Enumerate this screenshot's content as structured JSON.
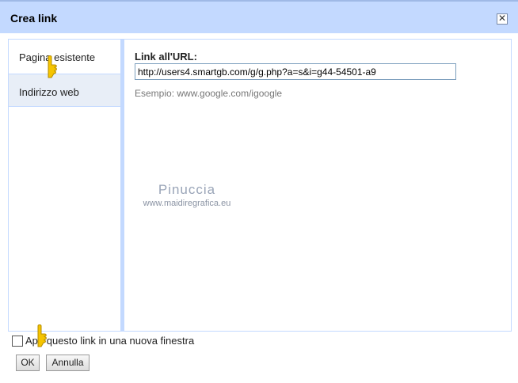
{
  "dialog": {
    "title": "Crea link",
    "close_glyph": "✕"
  },
  "tabs": [
    {
      "label": "Pagina esistente"
    },
    {
      "label": "Indirizzo web"
    }
  ],
  "form": {
    "url_label": "Link all'URL:",
    "url_value": "http://users4.smartgb.com/g/g.php?a=s&i=g44-54501-a9",
    "example_text": "Esempio: www.google.com/igoogle"
  },
  "watermark": {
    "line1": "Pinuccia",
    "line2": "www.maidiregrafica.eu"
  },
  "footer": {
    "checkbox_label": "Apri questo link in una nuova finestra",
    "checkbox_checked": false,
    "ok_label": "OK",
    "cancel_label": "Annulla"
  },
  "colors": {
    "titlebar": "#c3d9ff",
    "accent": "#c3d9ff",
    "hand_cursor": "#f5c400"
  }
}
